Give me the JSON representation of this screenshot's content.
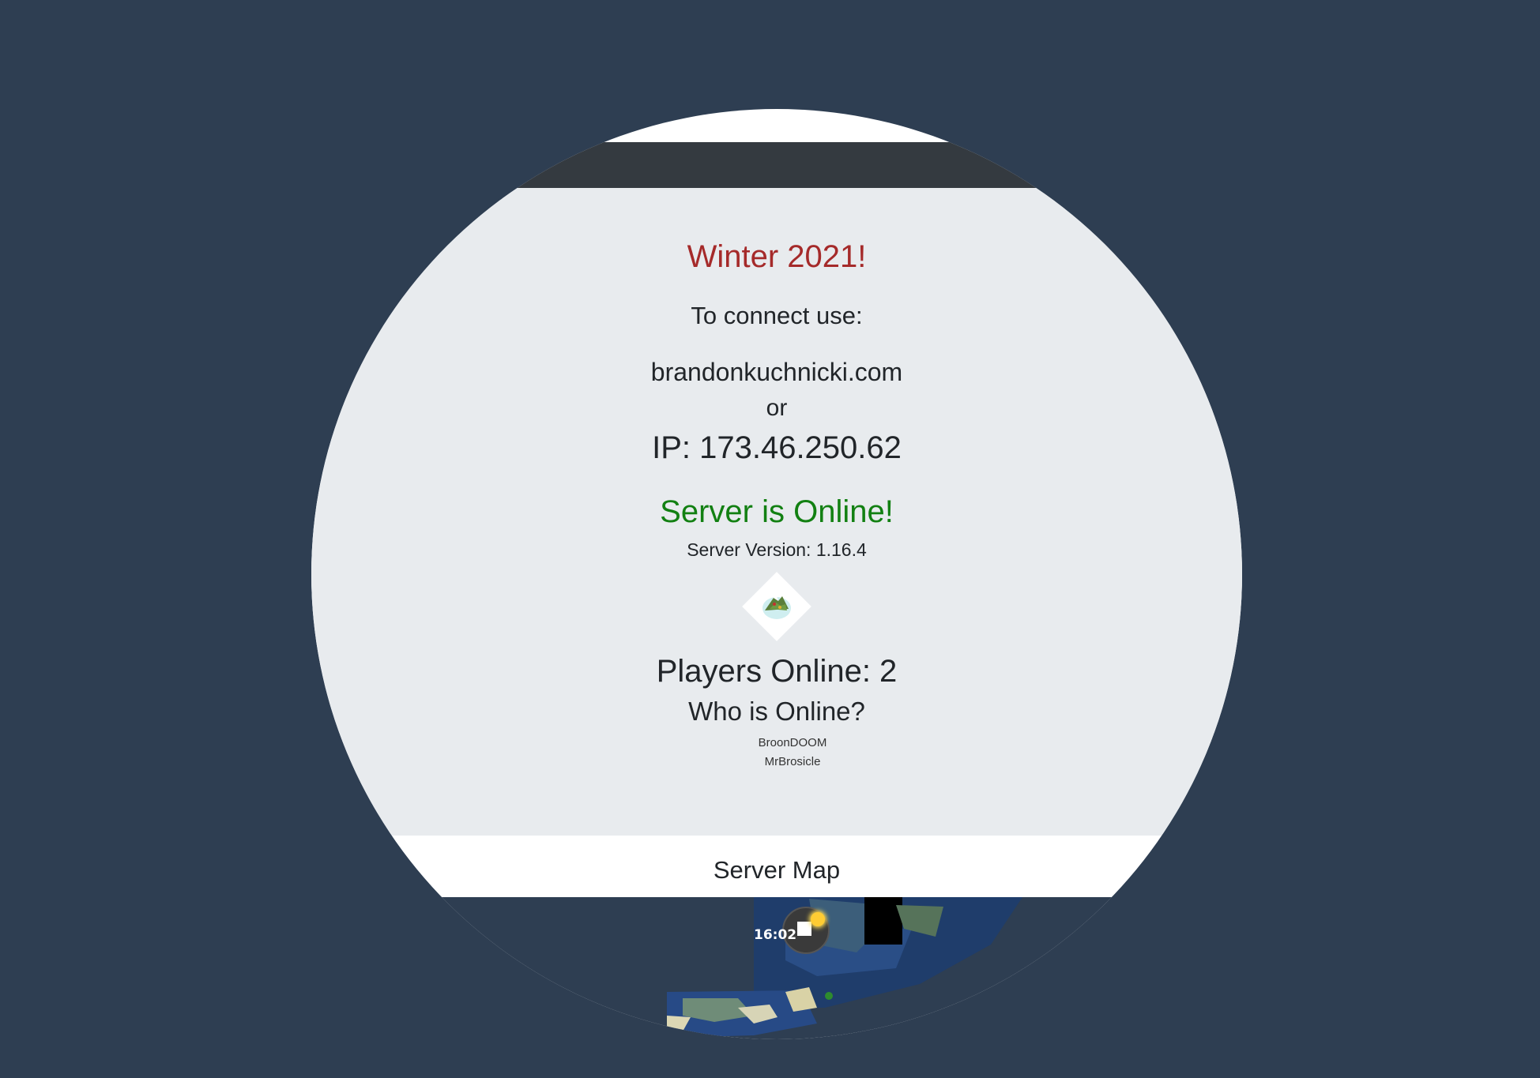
{
  "header": {
    "title": "Winter 2021!"
  },
  "connect": {
    "label": "To connect use:",
    "domain": "brandonkuchnicki.com",
    "separator": "or",
    "ip": "IP: 173.46.250.62"
  },
  "server": {
    "status": "Server is Online!",
    "version": "Server Version: 1.16.4",
    "icon": "server-icon"
  },
  "players": {
    "count_text": "Players Online: 2",
    "who_heading": "Who is Online?",
    "names": [
      "BroonDOOM",
      "MrBrosicle"
    ]
  },
  "map": {
    "title": "Server Map",
    "time": "16:02"
  },
  "colors": {
    "background": "#2e3e52",
    "title": "#a52a2a",
    "status_online": "#128012",
    "panel": "#e8ebee",
    "topbar": "#343a40"
  }
}
